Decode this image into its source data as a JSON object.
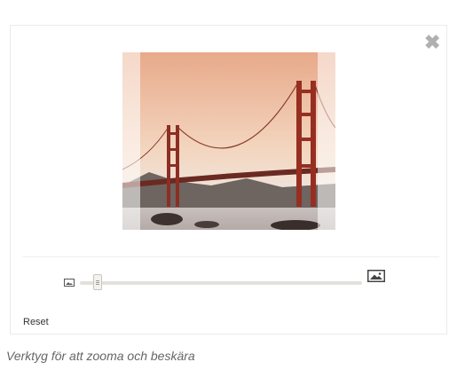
{
  "close": {
    "icon": "close-icon",
    "symbol": "✖"
  },
  "image": {
    "subject": "bridge-photo"
  },
  "zoom": {
    "min_icon": "small-image-icon",
    "max_icon": "large-image-icon",
    "level": 0.05
  },
  "reset_label": "Reset",
  "caption": "Verktyg för att zooma och beskära",
  "colors": {
    "track": "#e3e1dc",
    "border": "#ebebeb",
    "close": "#b0b0b0"
  }
}
